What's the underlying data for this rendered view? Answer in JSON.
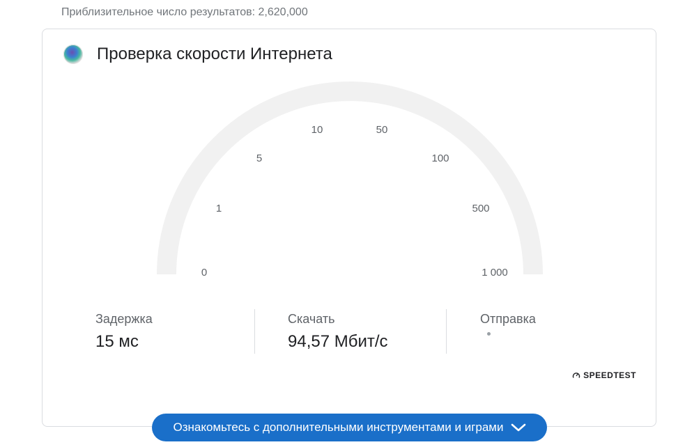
{
  "results": {
    "count_text": "Приблизительное число результатов: 2,620,000"
  },
  "card": {
    "title": "Проверка скорости Интернета",
    "logo_icon": "speedtest-orb-icon"
  },
  "gauge": {
    "ticks": [
      "0",
      "1",
      "5",
      "10",
      "50",
      "100",
      "500",
      "1 000"
    ],
    "track_color": "#f1f1f1"
  },
  "stats": {
    "latency": {
      "label": "Задержка",
      "value": "15 мс"
    },
    "download": {
      "label": "Скачать",
      "value": "94,57 Мбит/с"
    },
    "upload": {
      "label": "Отправка"
    }
  },
  "brand": {
    "name": "SPEEDTEST",
    "icon": "speedometer-icon"
  },
  "more_button": {
    "label": "Ознакомьтесь с дополнительными инструментами и играми",
    "icon": "chevron-down-icon",
    "color": "#1a6fc9"
  }
}
